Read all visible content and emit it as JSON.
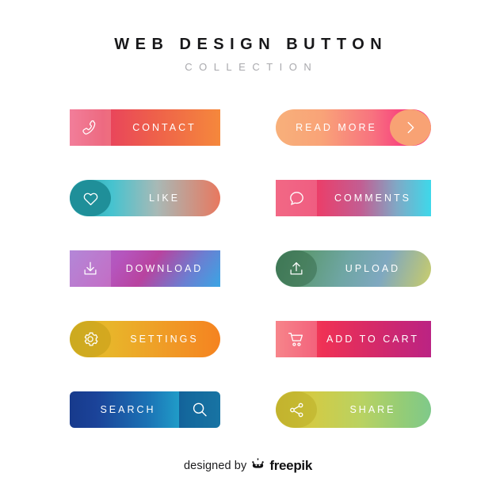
{
  "header": {
    "title": "WEB DESIGN BUTTON",
    "subtitle": "COLLECTION"
  },
  "buttons": [
    {
      "id": "contact",
      "label": "CONTACT",
      "icon": "phone-icon",
      "icon_side": "left",
      "shape": "rect",
      "gradient_from": "#ef5a7e",
      "gradient_to": "#f5883c"
    },
    {
      "id": "read-more",
      "label": "READ MORE",
      "icon": "chevron-right-icon",
      "icon_side": "right",
      "shape": "pill",
      "gradient_from": "#f8b07a",
      "gradient_to": "#f4247c"
    },
    {
      "id": "like",
      "label": "LIKE",
      "icon": "heart-icon",
      "icon_side": "left",
      "shape": "pill",
      "gradient_from": "#29a0a8",
      "gradient_to": "#e8785f"
    },
    {
      "id": "comments",
      "label": "COMMENTS",
      "icon": "speech-bubble-icon",
      "icon_side": "left",
      "shape": "rect",
      "gradient_from": "#f04a6d",
      "gradient_to": "#3ed8ea"
    },
    {
      "id": "download",
      "label": "DOWNLOAD",
      "icon": "download-arrow-icon",
      "icon_side": "left",
      "shape": "rect",
      "gradient_from": "#a46fd0",
      "gradient_to": "#3aa5e4"
    },
    {
      "id": "upload",
      "label": "UPLOAD",
      "icon": "upload-arrow-icon",
      "icon_side": "left",
      "shape": "pill",
      "gradient_from": "#4c8a66",
      "gradient_to": "#cbd06f"
    },
    {
      "id": "settings",
      "label": "SETTINGS",
      "icon": "gear-icon",
      "icon_side": "left",
      "shape": "pill",
      "gradient_from": "#ddb92b",
      "gradient_to": "#f58320"
    },
    {
      "id": "add-to-cart",
      "label": "ADD TO CART",
      "icon": "shopping-cart-icon",
      "icon_side": "left",
      "shape": "rect",
      "gradient_from": "#f5636a",
      "gradient_to": "#bb2383"
    },
    {
      "id": "search",
      "label": "SEARCH",
      "icon": "magnifier-icon",
      "icon_side": "right",
      "shape": "round",
      "gradient_from": "#173a8c",
      "gradient_to": "#28bad8"
    },
    {
      "id": "share",
      "label": "SHARE",
      "icon": "share-network-icon",
      "icon_side": "left",
      "shape": "pill",
      "gradient_from": "#cfc03c",
      "gradient_to": "#7fc98a"
    }
  ],
  "footer": {
    "designed_by": "designed by",
    "brand": "freepik",
    "logo_icon": "freepik-crown-icon"
  }
}
